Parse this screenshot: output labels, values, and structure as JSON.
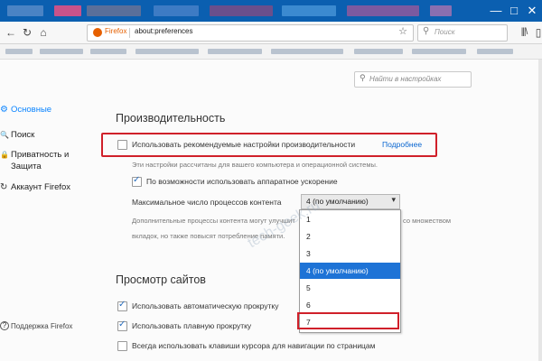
{
  "colors": {
    "accent": "#0a84ff",
    "highlight": "#d0202a",
    "selected": "#1e73d6",
    "title_bar": "#0b5fb0"
  },
  "window": {
    "minimize": "—",
    "maximize": "□",
    "close": "✕"
  },
  "toolbar": {
    "brand": "Firefox",
    "url": "about:preferences",
    "search_placeholder": "Поиск",
    "library_icon": "|||\\",
    "sidebar_icon": "▯"
  },
  "sidebar": {
    "items": [
      {
        "label": "Основные",
        "icon": "⚙",
        "active": true
      },
      {
        "label": "Поиск",
        "icon": "🔍",
        "active": false
      },
      {
        "label": "Приватность и",
        "label2": "Защита",
        "icon": "🔒",
        "active": false
      },
      {
        "label": "Аккаунт Firefox",
        "icon": "↻",
        "active": false
      }
    ],
    "support": "Поддержка Firefox",
    "support_icon": "?"
  },
  "find": {
    "placeholder": "Найти в настройках"
  },
  "performance": {
    "heading": "Производительность",
    "use_recommended": "Использовать рекомендуемые настройки производительности",
    "learn_more": "Подробнее",
    "recommended_desc": "Эти настройки рассчитаны для вашего компьютера и операционной системы.",
    "hw_accel": "По возможности использовать аппаратное ускорение",
    "max_processes_label": "Максимальное число процессов контента",
    "max_processes_value": "4 (по умолчанию)",
    "extra_desc_1": "Дополнительные процессы контента могут улучшит",
    "extra_desc_1b": "со множеством",
    "extra_desc_2": "вкладок, но также повысят потребление памяти."
  },
  "dropdown": {
    "options": [
      "1",
      "2",
      "3",
      "4 (по умолчанию)",
      "5",
      "6",
      "7"
    ],
    "selected_index": 3,
    "highlighted_index": 6
  },
  "browsing": {
    "heading": "Просмотр сайтов",
    "autoscroll": "Использовать автоматическую прокрутку",
    "smooth": "Использовать плавную прокрутку",
    "caret": "Всегда использовать клавиши курсора для навигации по страницам"
  },
  "watermark": "tech-geek.ru"
}
